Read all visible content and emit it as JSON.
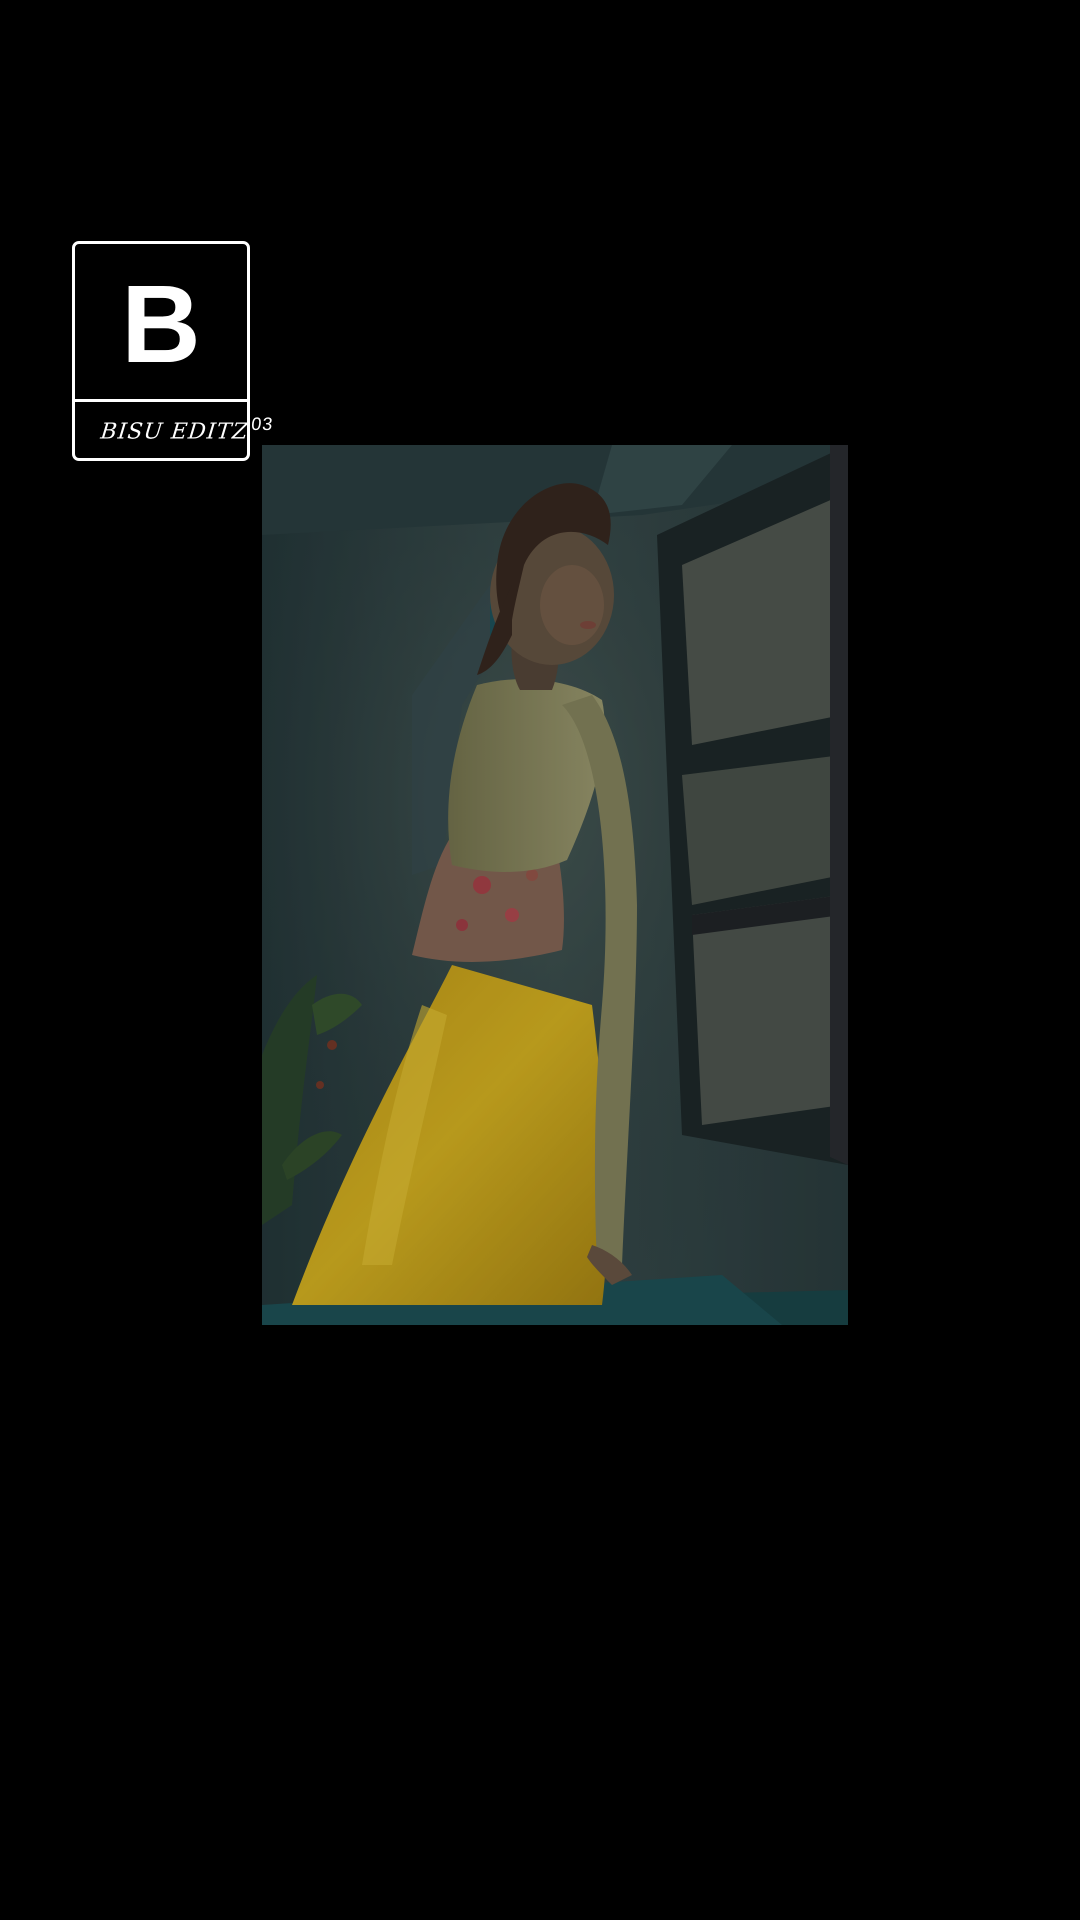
{
  "watermark": {
    "letter": "B",
    "caption": "BISU EDITZ",
    "superscript": "03"
  },
  "photo": {
    "subject": "photo-person-yellow-dress"
  },
  "colors": {
    "background": "#000000",
    "logo_border": "#ffffff",
    "dress": "#d6b11c",
    "wall": "#2f4346"
  }
}
